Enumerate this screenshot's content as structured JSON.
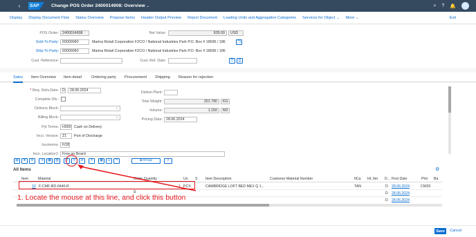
{
  "shell": {
    "title": "Change POS Order 2400014908: Overview",
    "logo": "SAP"
  },
  "toolbar": {
    "items": [
      "Display",
      "Display Document Flow",
      "Status Overview",
      "Propose Items",
      "Header Output Preview",
      "Reject Document",
      "Loading Units and Aggregation Categories",
      "Services for Object",
      "More"
    ],
    "exit": "Exit"
  },
  "header": {
    "pos_order_label": "POS Order:",
    "pos_order": "2400014908",
    "net_value_label": "Net Value:",
    "net_value": "835.00",
    "currency": "USD",
    "sold_to_label": "Sold-To Party:",
    "sold_to": "60000060",
    "sold_to_desc": "Marina Retail Corporation FZCO / National Industries Park P.O. Box # 18695 / 186",
    "ship_to_label": "Ship-To Party:",
    "ship_to": "60000060",
    "ship_to_desc": "Marina Retail Corporation FZCO / National Industries Park P.O. Box # 18695 / 186",
    "cust_ref_label": "Cust. Reference:",
    "cust_ref": "",
    "cust_ref_date_label": "Cust. Ref. Date:",
    "cust_ref_date": ""
  },
  "tabs": [
    "Sales",
    "Item Overview",
    "Item detail",
    "Ordering party",
    "Procurement",
    "Shipping",
    "Reason for rejection"
  ],
  "sales": {
    "req_deliv_label": "Req. Deliv.Date:",
    "req_deliv_type": "D",
    "req_deliv_date": "28.06.2024",
    "complete_dlv_label": "Complete Dlv.:",
    "delivery_block_label": "Delivery Block:",
    "billing_block_label": "Billing Block:",
    "pyt_terms_label": "Pyt Terms:",
    "pyt_terms": "H000",
    "pyt_terms_desc": "Cash on Delivery",
    "inco_version_label": "Inco. Version:",
    "inco_version": "Z1",
    "inco_version_desc": "Port of Discharge",
    "incoterms_label": "Incoterms:",
    "incoterms": "FOB",
    "inco_loc_label": "Inco. Location1:",
    "inco_loc": "Free on Board",
    "deliver_plant_label": "Deliver.Plant:",
    "deliver_plant": "",
    "total_weight_label": "Total Weight:",
    "total_weight": "201.780",
    "weight_unit": "KG",
    "volume_label": "Volume:",
    "volume": "1.150",
    "volume_unit": "M3",
    "pricing_date_label": "Pricing Date:",
    "pricing_date": "28.06.2024"
  },
  "items_toolbar": {
    "group_label": "Group"
  },
  "items": {
    "title": "All Items",
    "columns": [
      "Item",
      "Material",
      "Order Quantity",
      "Un",
      "S",
      "Item Description",
      "Customer Material Number",
      "ItCa",
      "HL Itm",
      "D...",
      "First Date",
      "Plnt",
      "Ba"
    ],
    "rows": [
      {
        "item": "10",
        "material": "F-CMF-BD-0440-R",
        "qty": "1",
        "un": "PCS",
        "desc": "CAMBRIDGE LOFT BED MEX Q 1...",
        "itca": "TAN",
        "d": "D",
        "first_date": "28.06.2024",
        "plnt": "CW20"
      },
      {
        "item": "",
        "material": "",
        "qty": "",
        "un": "",
        "desc": "",
        "itca": "",
        "d": "D",
        "first_date": "28.06.2024",
        "plnt": ""
      },
      {
        "item": "",
        "material": "",
        "qty": "",
        "un": "",
        "desc": "",
        "itca": "",
        "d": "D",
        "first_date": "28.06.2024",
        "plnt": ""
      }
    ]
  },
  "annotation": "1. Locate the mouse at this line, and click this button",
  "footer": {
    "save": "Save",
    "cancel": "Cancel"
  },
  "colors": {
    "shell": "#354a5f",
    "accent": "#0a6ed1",
    "annotation": "#e4161b"
  }
}
